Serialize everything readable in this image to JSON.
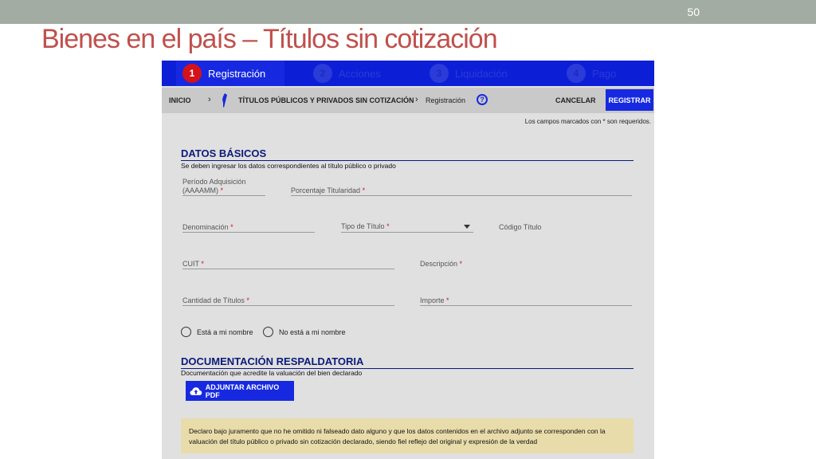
{
  "slide": {
    "number": "50",
    "title": "Bienes en el país – Títulos sin cotización"
  },
  "stepper": {
    "steps": [
      {
        "num": "1",
        "label": "Registración"
      },
      {
        "num": "2",
        "label": "Acciones"
      },
      {
        "num": "3",
        "label": "Liquidación"
      },
      {
        "num": "4",
        "label": "Pago"
      }
    ]
  },
  "toolbar": {
    "home": "INICIO",
    "separator": "›",
    "section": "TÍTULOS PÚBLICOS Y PRIVADOS SIN COTIZACIÓN",
    "current": "Registración",
    "cancel": "CANCELAR",
    "register": "REGISTRAR"
  },
  "required_note": "Los campos marcados con * son requeridos.",
  "datos_basicos": {
    "title": "DATOS BÁSICOS",
    "subtitle": "Se deben ingresar los datos correspondientes al título público o privado",
    "fields": {
      "periodo_line1": "Período Adquisición",
      "periodo_line2": "(AAAAMM)",
      "porcentaje": "Porcentaje Titularidad",
      "denominacion": "Denominación",
      "tipo_titulo": "Tipo de Título",
      "codigo_titulo": "Código Título",
      "cuit": "CUIT",
      "descripcion": "Descripción",
      "cantidad": "Cantidad de Títulos",
      "importe": "Importe"
    },
    "required_mark": "*",
    "radios": {
      "a_mi_nombre": "Está a mi nombre",
      "no_a_mi_nombre": "No está a mi nombre"
    }
  },
  "documentacion": {
    "title": "DOCUMENTACIÓN RESPALDATORIA",
    "subtitle": "Documentación que acredite la valuación del bien declarado",
    "attach_button": "ADJUNTAR ARCHIVO PDF"
  },
  "declaration": "Declaro bajo juramento que no he omitido ni falseado dato alguno  y que  los datos contenidos en el archivo adjunto se corresponden con la valuación del título público o privado sin cotización declarado, siendo fiel reflejo del original y expresión de la verdad",
  "colors": {
    "title_red": "#c0504d",
    "nav_blue": "#0d1fd6",
    "required_red": "#d4121a",
    "section_navy": "#0c1a7a",
    "declaration_bg": "#e8dcaa"
  }
}
